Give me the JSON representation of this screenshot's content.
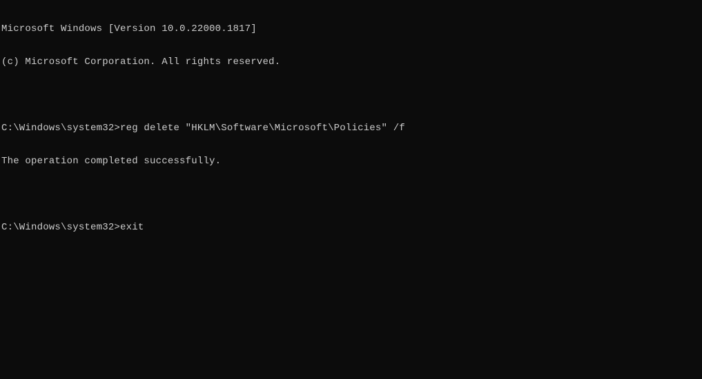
{
  "terminal": {
    "banner_line1": "Microsoft Windows [Version 10.0.22000.1817]",
    "banner_line2": "(c) Microsoft Corporation. All rights reserved.",
    "prompt1": "C:\\Windows\\system32>",
    "command1": "reg delete \"HKLM\\Software\\Microsoft\\Policies\" /f",
    "result1": "The operation completed successfully.",
    "prompt2": "C:\\Windows\\system32>",
    "command2": "exit"
  }
}
